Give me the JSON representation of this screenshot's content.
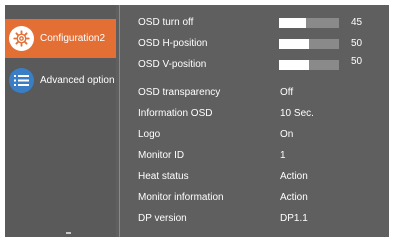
{
  "sidebar": {
    "items": [
      {
        "label": "Configuration2",
        "icon": "gear-icon",
        "active": true
      },
      {
        "label": "Advanced option",
        "icon": "list-icon",
        "active": false
      }
    ]
  },
  "colors": {
    "active_bg": "#e46f35",
    "panel_bg": "#5f5f5f",
    "icon_blue": "#3a7fc6"
  },
  "settings": [
    {
      "label": "OSD turn off",
      "type": "slider",
      "value": "45",
      "level": 0.45
    },
    {
      "label": "OSD H-position",
      "type": "slider",
      "value": "50",
      "level": 0.5
    },
    {
      "label": "OSD V-position",
      "type": "slider",
      "value": "50",
      "level": 0.5
    },
    {
      "label": "OSD transparency",
      "type": "text",
      "value": "Off"
    },
    {
      "label": "Information OSD",
      "type": "text",
      "value": "10 Sec."
    },
    {
      "label": "Logo",
      "type": "text",
      "value": "On"
    },
    {
      "label": "Monitor ID",
      "type": "text",
      "value": "1"
    },
    {
      "label": "Heat status",
      "type": "text",
      "value": "Action"
    },
    {
      "label": "Monitor information",
      "type": "text",
      "value": "Action"
    },
    {
      "label": "DP version",
      "type": "text",
      "value": "DP1.1"
    }
  ]
}
